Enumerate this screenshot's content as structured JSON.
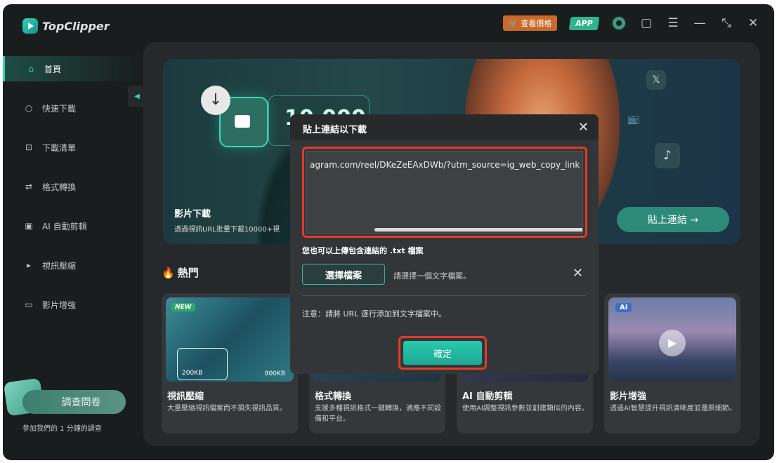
{
  "app": {
    "name": "TopClipper"
  },
  "titlebar": {
    "price_label": "查看價格",
    "app_label": "APP",
    "icons": [
      "cart-icon",
      "phone-icon",
      "avatar",
      "message-icon",
      "menu-icon",
      "minimize-icon",
      "resize-icon",
      "close-icon"
    ]
  },
  "sidebar": {
    "items": [
      {
        "label": "首頁",
        "icon": "home-icon",
        "active": true
      },
      {
        "label": "快速下載",
        "icon": "search-icon",
        "active": false
      },
      {
        "label": "下載清單",
        "icon": "download-list-icon",
        "active": false
      },
      {
        "label": "格式轉換",
        "icon": "convert-icon",
        "active": false
      },
      {
        "label": "AI 自動剪輯",
        "icon": "ai-edit-icon",
        "active": false
      },
      {
        "label": "視訊壓縮",
        "icon": "compress-icon",
        "active": false
      },
      {
        "label": "影片增強",
        "icon": "hd-icon",
        "active": false
      }
    ],
    "survey": {
      "button": "調查問卷",
      "text": "參加我們的 1 分鐘的調查"
    }
  },
  "banner": {
    "counter": "10,000+",
    "title": "影片下載",
    "subtitle": "透過視訊URL批量下載10000+視",
    "paste_button": "貼上連結 →"
  },
  "hot": {
    "title": "熱門",
    "cards": [
      {
        "title": "視訊壓縮",
        "desc": "大量壓縮視訊檔案而不損失視訊品質。",
        "tag": "NEW",
        "size_from": "200KB",
        "size_to": "800KB"
      },
      {
        "title": "格式轉換",
        "desc": "支援多種視訊格式一鍵轉換，適應不同設備和平台。"
      },
      {
        "title": "AI 自動剪輯",
        "desc": "使用AI調整視訊參數並創建類似的內容。"
      },
      {
        "title": "影片增強",
        "desc": "透過AI智慧提升視訊清晰度並還原細節。",
        "tag": "AI"
      }
    ]
  },
  "dialog": {
    "title": "貼上連結以下載",
    "url_value": "agram.com/reel/DKeZeEAxDWb/?utm_source=ig_web_copy_link",
    "txt_note": "您也可以上傳包含連結的 .txt 檔案",
    "choose_button": "選擇檔案",
    "choose_hint": "請選擇一個文字檔案。",
    "note": "注意：請將 URL 逐行添加到文字檔案中。",
    "confirm_button": "確定"
  },
  "colors": {
    "accent": "#2fd6b8",
    "highlight": "#e23b2b",
    "price": "#c96a2a"
  }
}
